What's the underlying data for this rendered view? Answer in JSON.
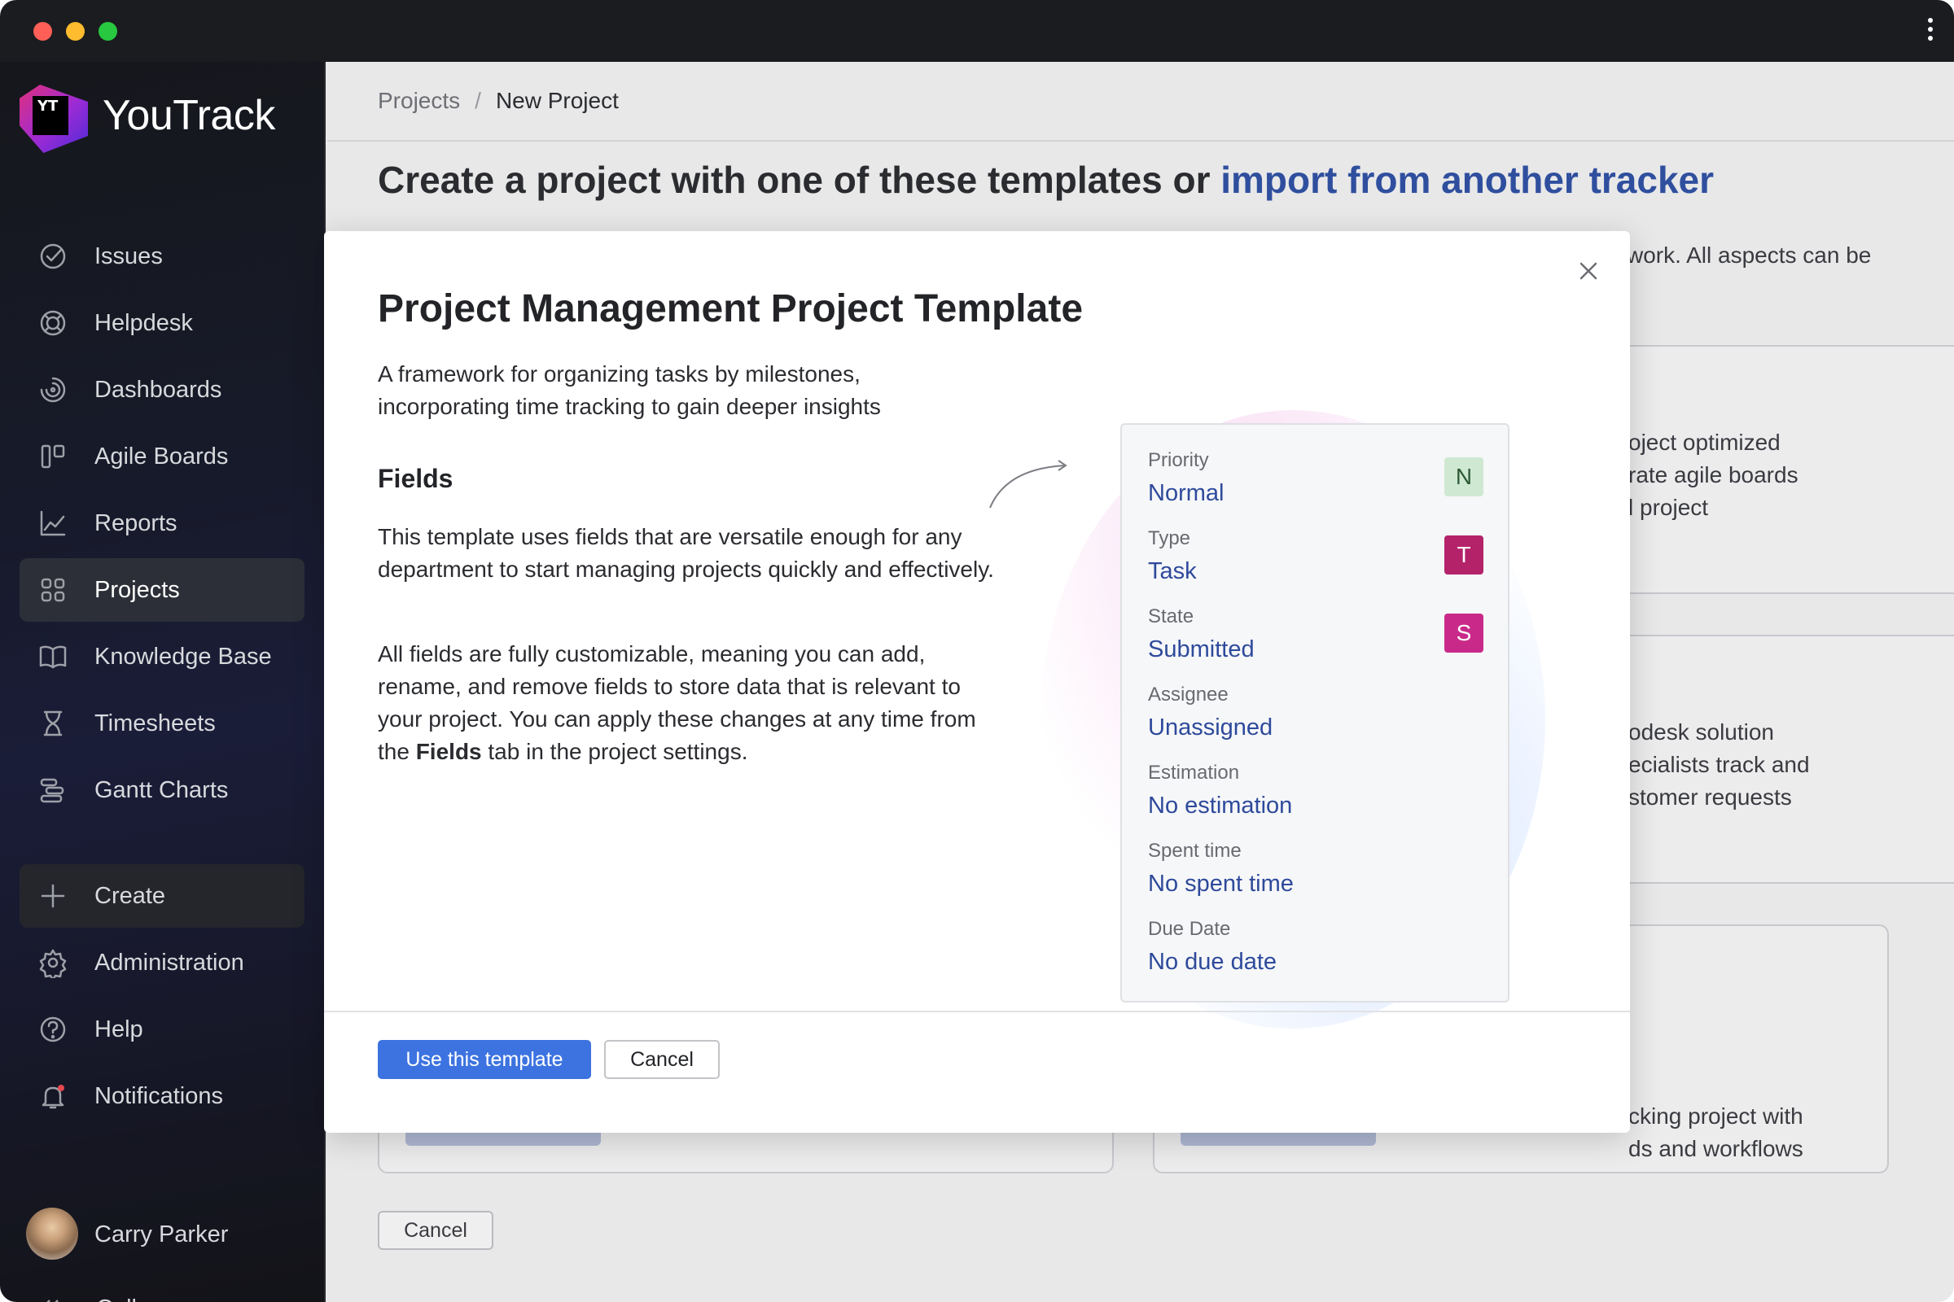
{
  "sidebar": {
    "brand": "YouTrack",
    "logo_text": "YT",
    "nav": [
      {
        "label": "Issues",
        "icon": "issues-icon"
      },
      {
        "label": "Helpdesk",
        "icon": "helpdesk-icon"
      },
      {
        "label": "Dashboards",
        "icon": "dashboards-icon"
      },
      {
        "label": "Agile Boards",
        "icon": "agile-boards-icon"
      },
      {
        "label": "Reports",
        "icon": "reports-icon"
      },
      {
        "label": "Projects",
        "icon": "projects-icon",
        "active": true
      },
      {
        "label": "Knowledge Base",
        "icon": "knowledge-base-icon"
      },
      {
        "label": "Timesheets",
        "icon": "timesheets-icon"
      },
      {
        "label": "Gantt Charts",
        "icon": "gantt-charts-icon"
      }
    ],
    "bottom": [
      {
        "label": "Create",
        "icon": "plus-icon"
      },
      {
        "label": "Administration",
        "icon": "gear-icon"
      },
      {
        "label": "Help",
        "icon": "help-icon"
      },
      {
        "label": "Notifications",
        "icon": "bell-icon"
      }
    ],
    "user_name": "Carry Parker",
    "collapse_label": "Collapse"
  },
  "breadcrumb": {
    "parent": "Projects",
    "separator": "/",
    "current": "New Project"
  },
  "page": {
    "title_prefix": "Create a project with one of these templates or ",
    "title_link": "import from another tracker",
    "desc_fragment": "work. All aspects can be",
    "card1_lines": [
      "oject optimized",
      "rate agile boards",
      "l project"
    ],
    "card2_lines": [
      "odesk solution",
      "ecialists track and",
      "stomer requests"
    ],
    "card3_lines": [
      "cking project with",
      "ds and workflows"
    ],
    "cancel_label": "Cancel"
  },
  "modal": {
    "title": "Project Management Project Template",
    "subtitle": "A framework for organizing tasks by milestones, incorporating time tracking to gain deeper insights",
    "fields_heading": "Fields",
    "paragraph1": "This template uses fields that are versatile enough for any department to start managing projects quickly and effectively.",
    "paragraph2_before": "All fields are fully customizable, meaning you can add, rename, and remove fields to store data that is relevant to your project. You can apply these changes at any time from the ",
    "paragraph2_bold": "Fields",
    "paragraph2_after": " tab in the project settings.",
    "fields": [
      {
        "label": "Priority",
        "value": "Normal",
        "badge": "N"
      },
      {
        "label": "Type",
        "value": "Task",
        "badge": "T"
      },
      {
        "label": "State",
        "value": "Submitted",
        "badge": "S"
      },
      {
        "label": "Assignee",
        "value": "Unassigned"
      },
      {
        "label": "Estimation",
        "value": "No estimation"
      },
      {
        "label": "Spent time",
        "value": "No spent time"
      },
      {
        "label": "Due Date",
        "value": "No due date"
      }
    ],
    "use_button": "Use this template",
    "cancel_button": "Cancel"
  },
  "colors": {
    "accent": "#3d73e0",
    "link": "#2e4a9b",
    "badge_normal": "#cfe8d2",
    "badge_task": "#b4226a",
    "badge_submitted": "#c92a8a"
  }
}
